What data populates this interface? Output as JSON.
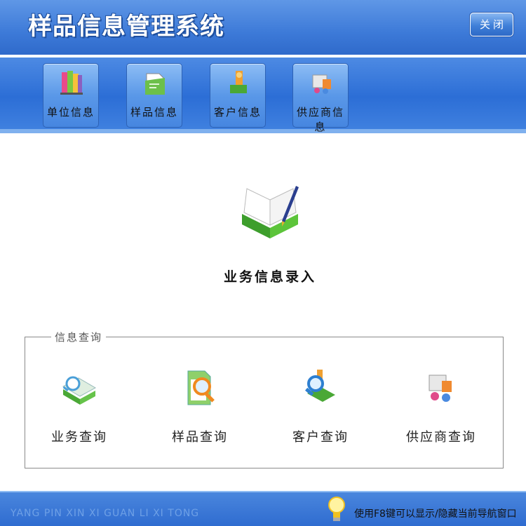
{
  "header": {
    "title": "样品信息管理系统",
    "close_label": "关闭"
  },
  "toolbar": {
    "items": [
      {
        "label": "单位信息",
        "icon": "books-icon"
      },
      {
        "label": "样品信息",
        "icon": "document-folder-icon"
      },
      {
        "label": "客户信息",
        "icon": "customer-icon"
      },
      {
        "label": "供应商信息",
        "icon": "supplier-icon"
      }
    ]
  },
  "main": {
    "entry_label": "业务信息录入",
    "entry_icon": "open-book-pen-icon"
  },
  "query": {
    "legend": "信息查询",
    "items": [
      {
        "label": "业务查询",
        "icon": "business-query-icon"
      },
      {
        "label": "样品查询",
        "icon": "sample-search-icon"
      },
      {
        "label": "客户查询",
        "icon": "customer-search-icon"
      },
      {
        "label": "供应商查询",
        "icon": "supplier-query-icon"
      }
    ]
  },
  "footer": {
    "brand": "YANG PIN XIN XI GUAN LI XI TONG",
    "tip": "使用F8键可以显示/隐藏当前导航窗口",
    "tip_icon": "lightbulb-icon"
  },
  "colors": {
    "header_blue": "#3d7ad8",
    "toolbar_blue": "#2c6ed6",
    "button_blue": "#5a98e8",
    "accent_green": "#5cc43a"
  }
}
